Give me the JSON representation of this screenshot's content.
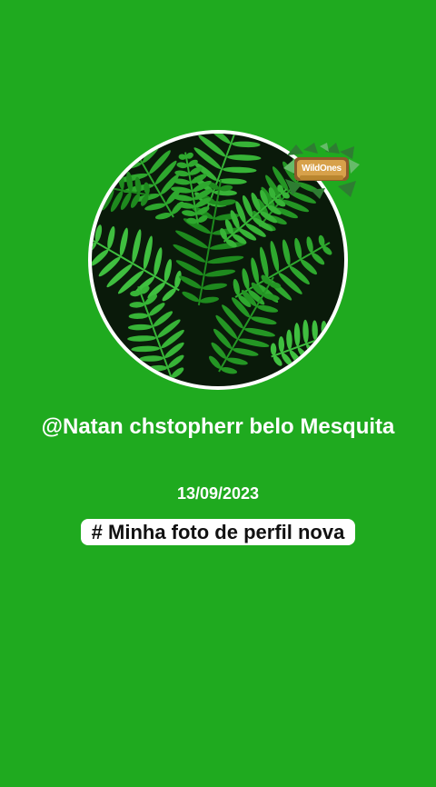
{
  "profile": {
    "username": "@Natan chstopherr belo Mesquita",
    "date": "13/09/2023",
    "caption": "# Minha foto de perfil nova"
  },
  "badge": {
    "logo_text": "WildOnes"
  },
  "colors": {
    "background": "#1faa1f",
    "avatar_ring": "#ffffff",
    "fern": "#2ea82e",
    "fern_dark": "#0a1a0a"
  },
  "icons": {
    "avatar": "fern-leaves-image",
    "badge": "wild-ones-logo"
  }
}
